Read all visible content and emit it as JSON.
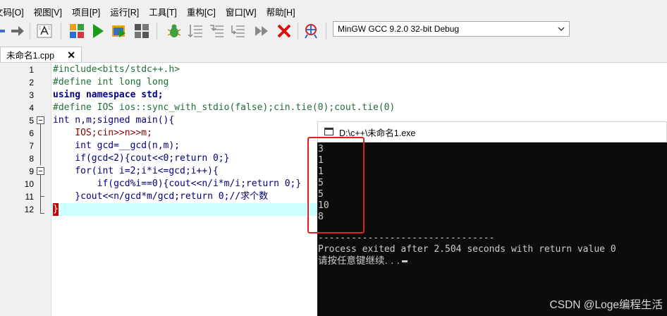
{
  "menu": [
    "文码[O]",
    "视图[V]",
    "项目[P]",
    "运行[R]",
    "工具[T]",
    "重构[C]",
    "窗口[W]",
    "帮助[H]"
  ],
  "toolbar": {
    "compiler": "MinGW GCC 9.2.0 32-bit Debug"
  },
  "tab": {
    "filename": "未命名1.cpp",
    "close": "✕"
  },
  "editor": {
    "line_numbers": [
      "1",
      "2",
      "3",
      "4",
      "5",
      "6",
      "7",
      "8",
      "9",
      "10",
      "11",
      "12"
    ],
    "lines": [
      "#include<bits/stdc++.h>",
      "#define int long long",
      "using namespace std;",
      "#define IOS ios::sync_with_stdio(false);cin.tie(0);cout.tie(0)",
      "int n,m;signed main(){",
      "    IOS;cin>>n>>m;",
      "    int gcd=__gcd(n,m);",
      "    if(gcd<2){cout<<0;return 0;}",
      "    for(int i=2;i*i<=gcd;i++){",
      "        if(gcd%i==0){cout<<n/i*m/i;return 0;}",
      "    }cout<<n/gcd*m/gcd;return 0;//求个数",
      "}"
    ],
    "current_line": 12
  },
  "console": {
    "title": "D:\\c++\\未命名1.exe",
    "output": "3\n1\n1\n5\n5\n10\n8",
    "separator": "--------------------------------",
    "exit_message": "Process exited after 2.504 seconds with return value 0",
    "press_key": "请按任意键继续. . ."
  },
  "colors": {
    "highlight_box": "#e02020",
    "console_bg": "#0c0c0c",
    "current_line": "#ccffff"
  },
  "watermark": "CSDN @Loge编程生活"
}
